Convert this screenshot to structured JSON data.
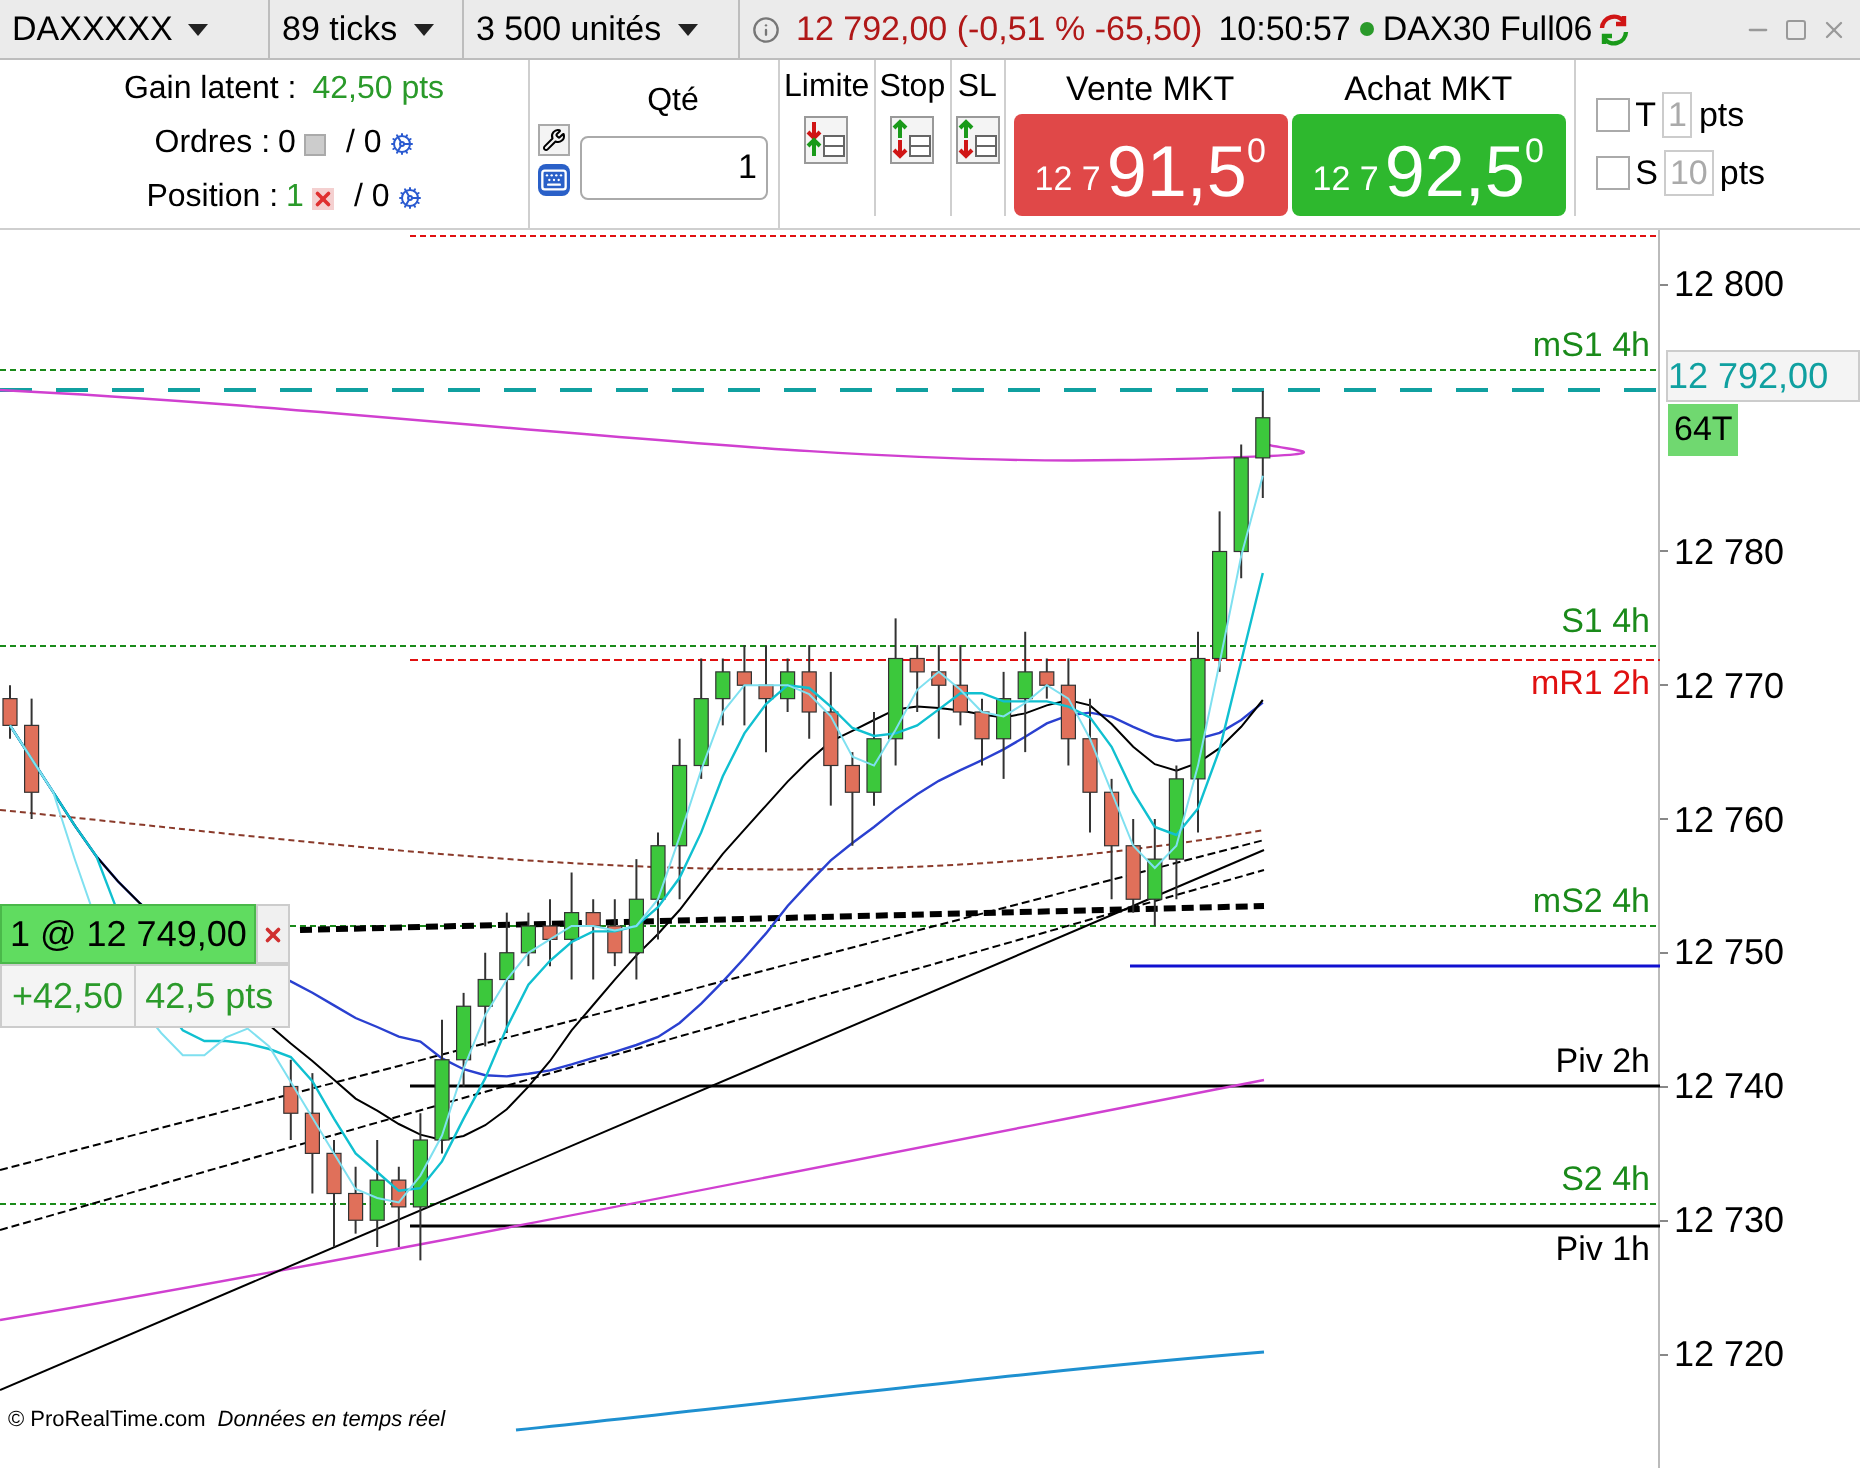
{
  "toolbar": {
    "instrument": "DAXXXXX",
    "interval": "89 ticks",
    "volume": "3 500 unités",
    "quote": "12 792,00 (-0,51 % -65,50)",
    "time": "10:50:57",
    "feed": "DAX30 Full06"
  },
  "order_panel": {
    "gain_label": "Gain latent :",
    "gain_value": "42,50 pts",
    "orders_label": "Ordres :",
    "orders_count": "0",
    "orders_auto": "/ 0",
    "position_label": "Position :",
    "position_count": "1",
    "position_auto": "/ 0",
    "qty_label": "Qté",
    "qty_value": "1",
    "order_types": [
      {
        "label": "Limite",
        "kind": "limit"
      },
      {
        "label": "Stop",
        "kind": "stop"
      },
      {
        "label": "SL",
        "kind": "stoplimit"
      }
    ],
    "market": [
      {
        "label": "Vente MKT",
        "kind": "sell",
        "prefix": "12 7",
        "price": "91,5",
        "sup": "0"
      },
      {
        "label": "Achat MKT",
        "kind": "buy",
        "prefix": "12 7",
        "price": "92,5",
        "sup": "0"
      }
    ],
    "options": [
      {
        "letter": "T",
        "value": "1",
        "unit": "pts",
        "checked": false
      },
      {
        "letter": "S",
        "value": "10",
        "unit": "pts",
        "checked": false
      }
    ]
  },
  "chart": {
    "price_labels": [
      "12 800",
      "12 780",
      "12 770",
      "12 760",
      "12 750",
      "12 740",
      "12 730",
      "12 720"
    ],
    "levels": [
      {
        "label": "mS1 4h",
        "color": "#1a8a1a",
        "kind": "dotted"
      },
      {
        "label": "S1 4h",
        "color": "#1a8a1a",
        "kind": "dotted"
      },
      {
        "label": "mR1 2h",
        "color": "#e01010",
        "kind": "dashed"
      },
      {
        "label": "mS2 4h",
        "color": "#1a8a1a",
        "kind": "dotted"
      },
      {
        "label": "Piv 2h",
        "color": "#000000",
        "kind": "solid"
      },
      {
        "label": "S2 4h",
        "color": "#1a8a1a",
        "kind": "dotted"
      },
      {
        "label": "Piv 1h",
        "color": "#000000",
        "kind": "solid"
      }
    ],
    "current_price": "12 792,00",
    "tick_badge": "64T",
    "position": {
      "summary": "1 @ 12 749,00",
      "pnl": "+42,50",
      "pts": "42,5 pts"
    },
    "footer": {
      "copyright": "© ProRealTime.com",
      "note": "Données en temps réel"
    }
  }
}
